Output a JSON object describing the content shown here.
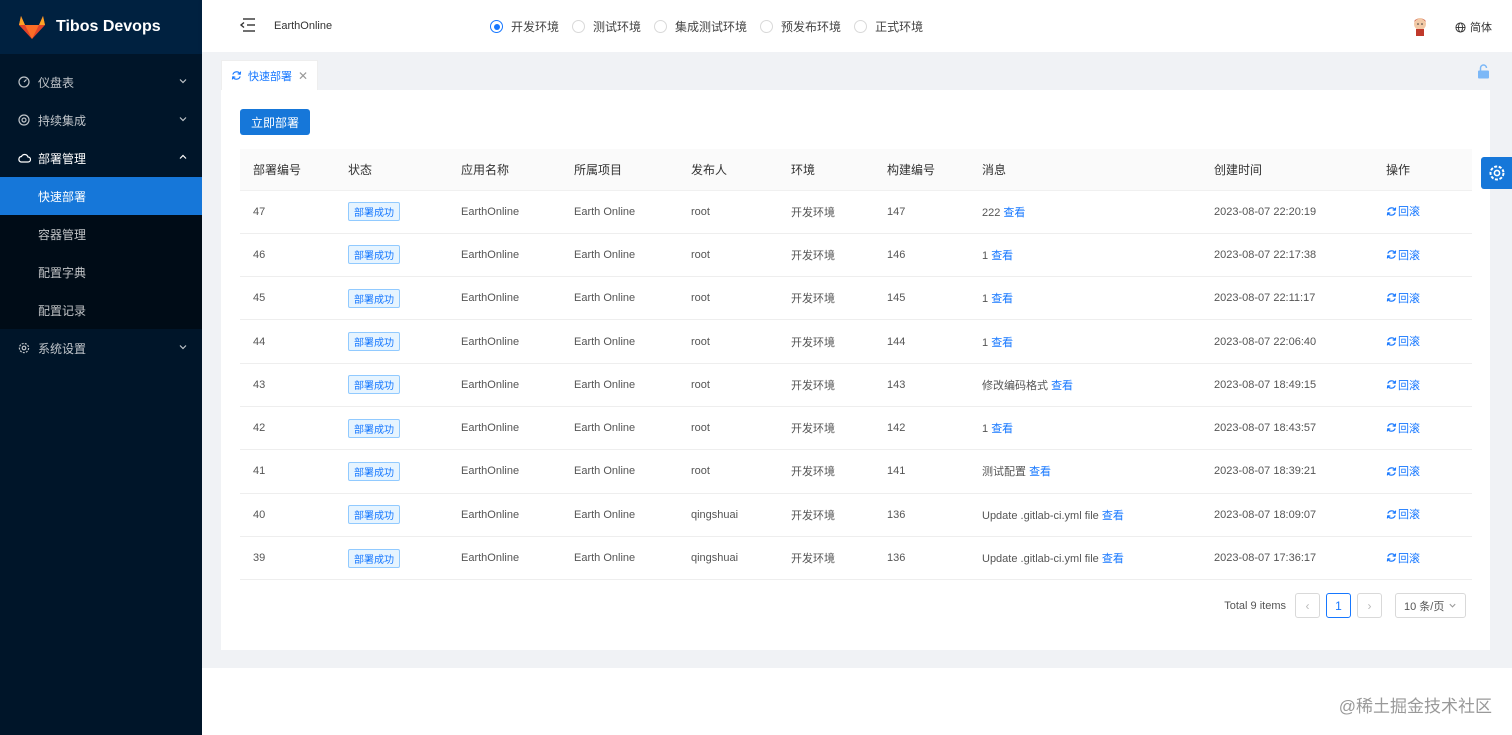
{
  "app": {
    "title": "Tibos Devops"
  },
  "sidebar": {
    "items": [
      {
        "label": "仪盘表",
        "icon": "dashboard-icon"
      },
      {
        "label": "持续集成",
        "icon": "integration-icon"
      },
      {
        "label": "部署管理",
        "icon": "cloud-icon"
      },
      {
        "label": "系统设置",
        "icon": "gear-icon"
      }
    ],
    "submenu": [
      "快速部署",
      "容器管理",
      "配置字典",
      "配置记录"
    ],
    "active_item": "快速部署"
  },
  "header": {
    "project": "EarthOnline",
    "environments": [
      "开发环境",
      "测试环境",
      "集成测试环境",
      "预发布环境",
      "正式环境"
    ],
    "selected_environment": "开发环境",
    "language": "简体"
  },
  "tabs": [
    {
      "label": "快速部署"
    }
  ],
  "main": {
    "deploy_button": "立即部署",
    "columns": [
      "部署编号",
      "状态",
      "应用名称",
      "所属项目",
      "发布人",
      "环境",
      "构建编号",
      "消息",
      "创建时间",
      "操作"
    ],
    "view_label": "查看",
    "rollback_label": "回滚",
    "rows": [
      {
        "id": "47",
        "status": "部署成功",
        "app": "EarthOnline",
        "project": "Earth Online",
        "publisher": "root",
        "env": "开发环境",
        "build": "147",
        "message": "222",
        "created": "2023-08-07 22:20:19"
      },
      {
        "id": "46",
        "status": "部署成功",
        "app": "EarthOnline",
        "project": "Earth Online",
        "publisher": "root",
        "env": "开发环境",
        "build": "146",
        "message": "1",
        "created": "2023-08-07 22:17:38"
      },
      {
        "id": "45",
        "status": "部署成功",
        "app": "EarthOnline",
        "project": "Earth Online",
        "publisher": "root",
        "env": "开发环境",
        "build": "145",
        "message": "1",
        "created": "2023-08-07 22:11:17"
      },
      {
        "id": "44",
        "status": "部署成功",
        "app": "EarthOnline",
        "project": "Earth Online",
        "publisher": "root",
        "env": "开发环境",
        "build": "144",
        "message": "1",
        "created": "2023-08-07 22:06:40"
      },
      {
        "id": "43",
        "status": "部署成功",
        "app": "EarthOnline",
        "project": "Earth Online",
        "publisher": "root",
        "env": "开发环境",
        "build": "143",
        "message": "修改编码格式",
        "created": "2023-08-07 18:49:15"
      },
      {
        "id": "42",
        "status": "部署成功",
        "app": "EarthOnline",
        "project": "Earth Online",
        "publisher": "root",
        "env": "开发环境",
        "build": "142",
        "message": "1",
        "created": "2023-08-07 18:43:57"
      },
      {
        "id": "41",
        "status": "部署成功",
        "app": "EarthOnline",
        "project": "Earth Online",
        "publisher": "root",
        "env": "开发环境",
        "build": "141",
        "message": "测试配置",
        "created": "2023-08-07 18:39:21"
      },
      {
        "id": "40",
        "status": "部署成功",
        "app": "EarthOnline",
        "project": "Earth Online",
        "publisher": "qingshuai",
        "env": "开发环境",
        "build": "136",
        "message": "Update .gitlab-ci.yml file",
        "created": "2023-08-07 18:09:07"
      },
      {
        "id": "39",
        "status": "部署成功",
        "app": "EarthOnline",
        "project": "Earth Online",
        "publisher": "qingshuai",
        "env": "开发环境",
        "build": "136",
        "message": "Update .gitlab-ci.yml file",
        "created": "2023-08-07 17:36:17"
      }
    ]
  },
  "pagination": {
    "total": "Total 9 items",
    "current_page": "1",
    "page_size": "10 条/页"
  },
  "watermark": "@稀土掘金技术社区",
  "colors": {
    "primary": "#1677d9",
    "sidebar_bg": "#001529",
    "link": "#1677ff"
  }
}
